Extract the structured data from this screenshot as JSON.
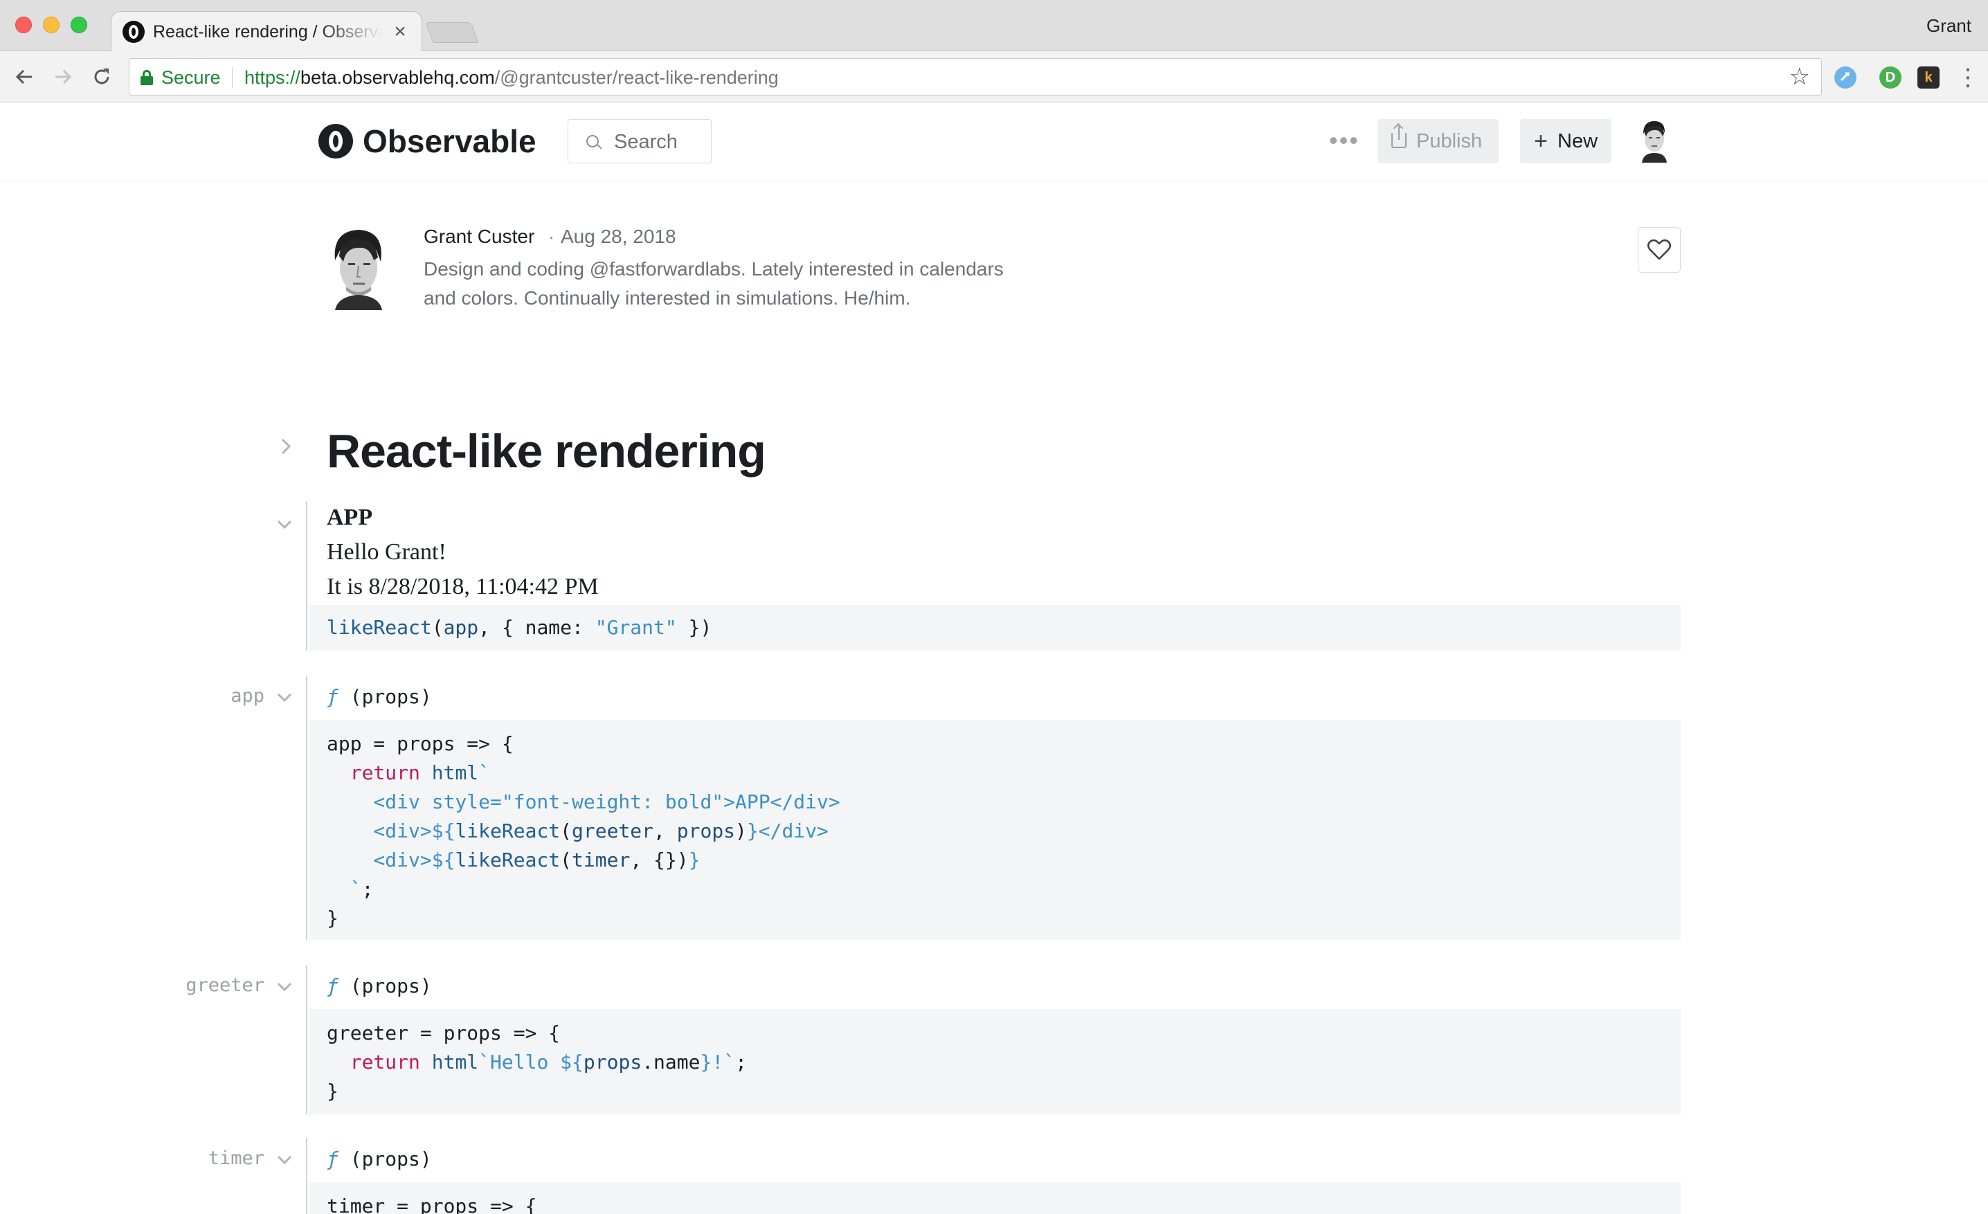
{
  "browser": {
    "tab_title": "React-like rendering / Observable",
    "tab_close": "×",
    "profile_name": "Grant",
    "security_label": "Secure",
    "url_scheme": "https://",
    "url_host": "beta.observablehq.com",
    "url_path": "/@grantcuster/react-like-rendering",
    "extensions": [
      "",
      "D",
      "k"
    ],
    "icons": [
      "back-arrow-icon",
      "forward-arrow-icon",
      "reload-icon",
      "lock-icon",
      "star-icon",
      "more-vert-icon"
    ]
  },
  "header": {
    "brand": "Observable",
    "search_label": "Search",
    "publish_label": "Publish",
    "new_label": "New",
    "more": "•••"
  },
  "author": {
    "name": "Grant Custer",
    "separator": "·",
    "date": "Aug 28, 2018",
    "bio_line1": "Design and coding @fastforwardlabs. Lately interested in calendars",
    "bio_line2": "and colors. Continually interested in simulations. He/him."
  },
  "notebook": {
    "title": "React-like rendering",
    "cells": [
      {
        "name": "",
        "output": {
          "heading": "APP",
          "line1": "Hello Grant!",
          "line2": "It is 8/28/2018, 11:04:42 PM"
        },
        "code": "likeReact(app, { name: \"Grant\" })"
      },
      {
        "name": "app",
        "signature": "ƒ (props)",
        "code": "app = props => {\n  return html`\n    <div style=\"font-weight: bold\">APP</div>\n    <div>${likeReact(greeter, props)}</div>\n    <div>${likeReact(timer, {})}\n  `;\n}"
      },
      {
        "name": "greeter",
        "signature": "ƒ (props)",
        "code": "greeter = props => {\n  return html`Hello ${props.name}!`;\n}"
      },
      {
        "name": "timer",
        "signature": "ƒ (props)",
        "code": "timer = props => {"
      }
    ]
  },
  "colors": {
    "keyword": "#c3185c",
    "string": "#3b8fc4",
    "code_bg": "#f4f5f6",
    "secure_green": "#198733"
  }
}
